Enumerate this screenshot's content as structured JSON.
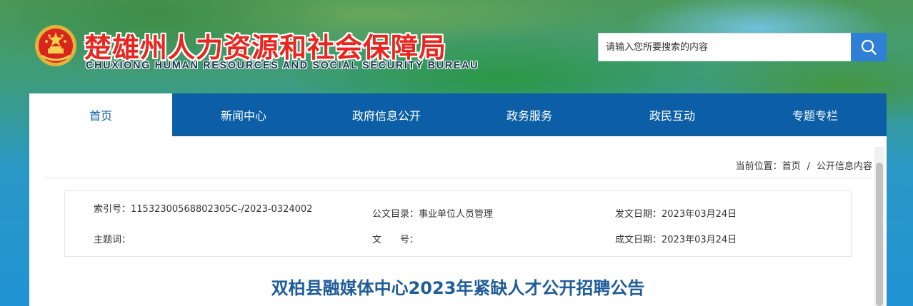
{
  "header": {
    "title": "楚雄州人力资源和社会保障局",
    "subtitle": "CHUXIONG HUMAN RESOURCES AND SOCIAL SECURITY BUREAU",
    "emblem_icon": "national-emblem-icon",
    "title_color": "#e8261f"
  },
  "search": {
    "placeholder": "请输入您所要搜索的内容",
    "button_icon": "search-icon"
  },
  "nav": {
    "items": [
      {
        "label": "首页",
        "active": true
      },
      {
        "label": "新闻中心"
      },
      {
        "label": "政府信息公开"
      },
      {
        "label": "政务服务"
      },
      {
        "label": "政民互动"
      },
      {
        "label": "专题专栏"
      }
    ],
    "bg_color": "#0c5fa6"
  },
  "breadcrumb": {
    "prefix": "当前位置：",
    "items": [
      "首页",
      "公开信息内容"
    ],
    "separator": "/"
  },
  "meta": {
    "index_label": "索引号：",
    "index_value": "11532300568802305C-/2023-0324002",
    "catalog_label": "公文目录：",
    "catalog_value": "事业单位人员管理",
    "publish_label": "发文日期：",
    "publish_value": "2023年03月24日",
    "subject_label": "主题词：",
    "subject_value": "",
    "docno_label": "文　　号：",
    "docno_value": "",
    "created_label": "成文日期：",
    "created_value": "2023年03月24日"
  },
  "article": {
    "title": "双柏县融媒体中心2023年紧缺人才公开招聘公告",
    "title_color": "#1f5c9a"
  }
}
